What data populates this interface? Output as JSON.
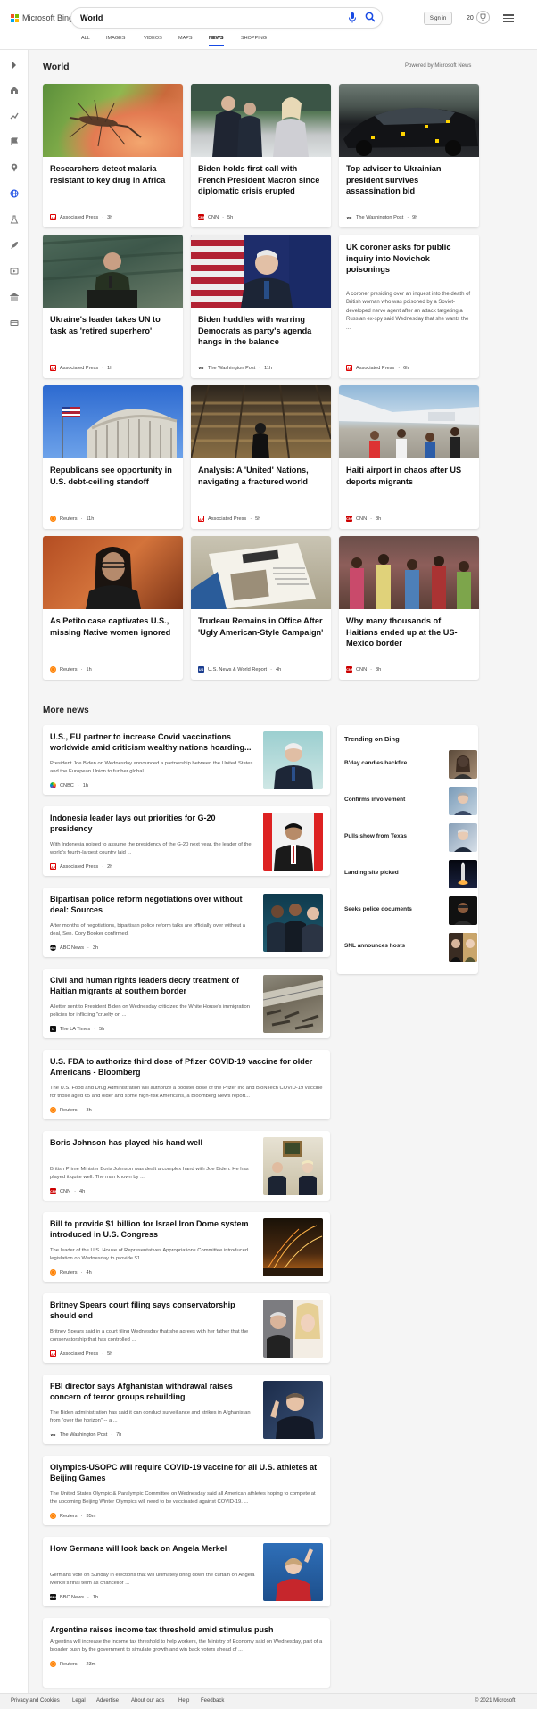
{
  "brand": {
    "name": "Microsoft Bing",
    "colors": [
      "#f25022",
      "#7fba00",
      "#00a4ef",
      "#ffb900"
    ]
  },
  "search": {
    "value": "World"
  },
  "header": {
    "signin": "Sign in",
    "rewards": "20",
    "mic_icon": "microphone-icon",
    "search_icon": "search-icon",
    "menu_icon": "hamburger-icon"
  },
  "tabs": [
    "ALL",
    "IMAGES",
    "VIDEOS",
    "MAPS",
    "NEWS",
    "SHOPPING"
  ],
  "active_tab": "NEWS",
  "accent": "#174ae4",
  "rail_icons": [
    "expand-icon",
    "home-icon",
    "trending-icon",
    "flag-icon",
    "location-icon",
    "globe-icon",
    "science-icon",
    "rocket-icon",
    "entertainment-icon",
    "politics-icon",
    "money-icon"
  ],
  "section": {
    "title": "World",
    "powered": "Powered by Microsoft News"
  },
  "cards": [
    {
      "title": "Researchers detect malaria resistant to key drug in Africa",
      "source": "Associated Press",
      "time": "3h",
      "logo": "ap",
      "logo_text": "AP"
    },
    {
      "title": "Biden holds first call with French President Macron since diplomatic crisis erupted",
      "source": "CNN",
      "time": "5h",
      "logo": "cnn",
      "logo_text": "CNN"
    },
    {
      "title": "Top adviser to Ukrainian president survives assassination bid",
      "source": "The Washington Post",
      "time": "9h",
      "logo": "wp",
      "logo_text": "wp"
    },
    {
      "title": "Ukraine's leader takes UN to task as 'retired superhero'",
      "source": "Associated Press",
      "time": "1h",
      "logo": "ap",
      "logo_text": "AP"
    },
    {
      "title": "Biden huddles with warring Democrats as party's agenda hangs in the balance",
      "source": "The Washington Post",
      "time": "11h",
      "logo": "wp",
      "logo_text": "wp"
    },
    {
      "title": "UK coroner asks for public inquiry into Novichok poisonings",
      "snippet": "A coroner presiding over an inquest into the death of British woman who was poisoned by a Soviet-developed nerve agent after an attack targeting a Russian ex-spy said Wednesday that she wants the ...",
      "source": "Associated Press",
      "time": "6h",
      "logo": "ap",
      "logo_text": "AP"
    },
    {
      "title": "Republicans see opportunity in U.S. debt-ceiling standoff",
      "source": "Reuters",
      "time": "11h",
      "logo": "reu",
      "logo_text": ""
    },
    {
      "title": "Analysis: A 'United' Nations, navigating a fractured world",
      "source": "Associated Press",
      "time": "5h",
      "logo": "ap",
      "logo_text": "AP"
    },
    {
      "title": "Haiti airport in chaos after US deports migrants",
      "source": "CNN",
      "time": "8h",
      "logo": "cnn",
      "logo_text": "CNN"
    },
    {
      "title": "As Petito case captivates U.S., missing Native women ignored",
      "source": "Reuters",
      "time": "1h",
      "logo": "reu",
      "logo_text": ""
    },
    {
      "title": "Trudeau Remains in Office After 'Ugly American-Style Campaign'",
      "source": "U.S. News & World Report",
      "time": "4h",
      "logo": "usn",
      "logo_text": "US"
    },
    {
      "title": "Why many thousands of Haitians ended up at the US-Mexico border",
      "source": "CNN",
      "time": "3h",
      "logo": "cnn",
      "logo_text": "CNN"
    }
  ],
  "more_news": {
    "title": "More news",
    "items": [
      {
        "title": "U.S., EU partner to increase Covid vaccinations worldwide amid criticism wealthy nations hoarding...",
        "snippet": "President Joe Biden on Wednesday announced a partnership between the United States and the European Union to further global ...",
        "source": "CNBC",
        "time": "1h",
        "logo": "cnbc",
        "logo_text": "",
        "has_thumb": true
      },
      {
        "title": "Indonesia leader lays out priorities for G-20 presidency",
        "snippet": "With Indonesia poised to assume the presidency of the G-20 next year, the leader of the world's fourth-largest country laid ...",
        "source": "Associated Press",
        "time": "2h",
        "logo": "ap",
        "logo_text": "AP",
        "has_thumb": true
      },
      {
        "title": "Bipartisan police reform negotiations over without deal: Sources",
        "snippet": "After months of negotiations, bipartisan police reform talks are officially over without a deal, Sen. Cory Booker confirmed.",
        "source": "ABC News",
        "time": "3h",
        "logo": "abc",
        "logo_text": "abc",
        "has_thumb": true
      },
      {
        "title": "Civil and human rights leaders decry treatment of Haitian migrants at southern border",
        "snippet": "A letter sent to President Biden on Wednesday criticized the White House's immigration policies for inflicting \"cruelty on ...",
        "source": "The LA Times",
        "time": "5h",
        "logo": "lat",
        "logo_text": "L",
        "has_thumb": true
      },
      {
        "title": "U.S. FDA to authorize third dose of Pfizer COVID-19 vaccine for older Americans - Bloomberg",
        "snippet": "The U.S. Food and Drug Administration will authorize a booster dose of the Pfizer Inc and BioNTech COVID-19 vaccine for those aged 65 and older and some high-risk Americans, a Bloomberg News report...",
        "source": "Reuters",
        "time": "3h",
        "logo": "reu",
        "logo_text": "",
        "has_thumb": false
      },
      {
        "title": "Boris Johnson has played his hand well",
        "snippet": "British Prime Minister Boris Johnson was dealt a complex hand with Joe Biden. He has played it quite well. The man known by ...",
        "source": "CNN",
        "time": "4h",
        "logo": "cnn",
        "logo_text": "CNN",
        "has_thumb": true
      },
      {
        "title": "Bill to provide $1 billion for Israel Iron Dome system introduced in U.S. Congress",
        "snippet": "The leader of the U.S. House of Representatives Appropriations Committee introduced legislation on Wednesday to provide $1 ...",
        "source": "Reuters",
        "time": "4h",
        "logo": "reu",
        "logo_text": "",
        "has_thumb": true
      },
      {
        "title": "Britney Spears court filing says conservatorship should end",
        "snippet": "Britney Spears said in a court filing Wednesday that she agrees with her father that the conservatorship that has controlled ...",
        "source": "Associated Press",
        "time": "5h",
        "logo": "ap",
        "logo_text": "AP",
        "has_thumb": true
      },
      {
        "title": "FBI director says Afghanistan withdrawal raises concern of terror groups rebuilding",
        "snippet": "The Biden administration has said it can conduct surveillance and strikes in Afghanistan from \"over the horizon\" -- a ...",
        "source": "The Washington Post",
        "time": "7h",
        "logo": "wp",
        "logo_text": "wp",
        "has_thumb": true
      },
      {
        "title": "Olympics-USOPC will require COVID-19 vaccine for all U.S. athletes at Beijing Games",
        "snippet": "The United States Olympic & Paralympic Committee on Wednesday said all American athletes hoping to compete at the upcoming Beijing Winter Olympics will need to be vaccinated against COVID-19. ...",
        "source": "Reuters",
        "time": "35m",
        "logo": "reu",
        "logo_text": "",
        "has_thumb": false
      },
      {
        "title": "How Germans will look back on Angela Merkel",
        "snippet": "Germans vote on Sunday in elections that will ultimately bring down the curtain on Angela Merkel's final term as chancellor ...",
        "source": "BBC News",
        "time": "1h",
        "logo": "bbc",
        "logo_text": "BBC",
        "has_thumb": true
      },
      {
        "title": "Argentina raises income tax threshold amid stimulus push",
        "snippet": "Argentina will increase the income tax threshold to help workers, the Ministry of Economy said on Wednesday, part of a broader push by the government to simulate growth and win back voters ahead of ...",
        "source": "Reuters",
        "time": "23m",
        "logo": "reu",
        "logo_text": "",
        "has_thumb": false
      }
    ]
  },
  "trending": {
    "title": "Trending on Bing",
    "items": [
      "B'day candles backfire",
      "Confirms involvement",
      "Pulls show from Texas",
      "Landing site picked",
      "Seeks police documents",
      "SNL announces hosts"
    ]
  },
  "footer": {
    "links": [
      "Privacy and Cookies",
      "Legal",
      "Advertise",
      "About our ads",
      "Help",
      "Feedback"
    ],
    "copyright": "© 2021 Microsoft"
  }
}
